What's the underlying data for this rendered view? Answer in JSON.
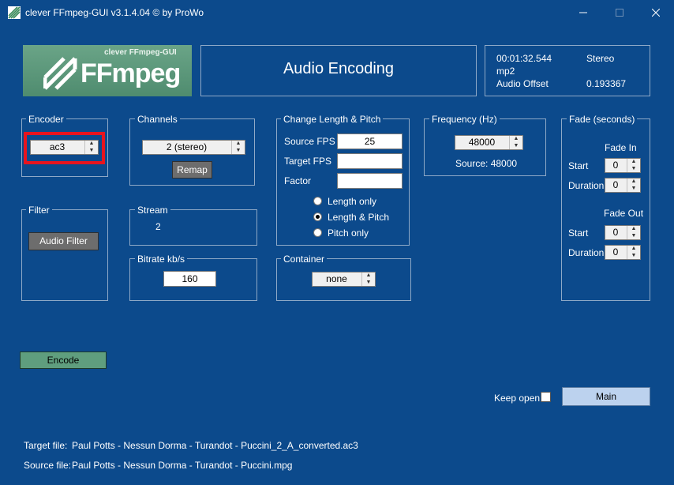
{
  "window": {
    "title": "clever FFmpeg-GUI v3.1.4.04   © by ProWo",
    "minimize_icon": "minimize-icon",
    "maximize_icon": "maximize-icon",
    "close_icon": "close-icon"
  },
  "logo": {
    "subtitle": "clever FFmpeg-GUI",
    "name": "FFmpeg"
  },
  "header": {
    "title": "Audio Encoding"
  },
  "info": {
    "duration": "00:01:32.544",
    "channels_mode": "Stereo",
    "codec": "mp2",
    "audio_offset_label": "Audio Offset",
    "audio_offset_value": "0.193367"
  },
  "encoder": {
    "legend": "Encoder",
    "value": "ac3"
  },
  "channels": {
    "legend": "Channels",
    "value": "2 (stereo)",
    "remap_label": "Remap"
  },
  "pitch": {
    "legend": "Change Length & Pitch",
    "source_fps_label": "Source FPS",
    "source_fps_value": "25",
    "target_fps_label": "Target FPS",
    "target_fps_value": "",
    "factor_label": "Factor",
    "factor_value": "",
    "options": [
      "Length only",
      "Length & Pitch",
      "Pitch only"
    ],
    "selected": "Length & Pitch"
  },
  "frequency": {
    "legend": "Frequency (Hz)",
    "value": "48000",
    "source": "Source: 48000"
  },
  "fade": {
    "legend": "Fade (seconds)",
    "fade_in_label": "Fade In",
    "fade_out_label": "Fade Out",
    "start_label": "Start",
    "duration_label": "Duration",
    "in_start": "0",
    "in_duration": "0",
    "out_start": "0",
    "out_duration": "0"
  },
  "filter": {
    "legend": "Filter",
    "button_label": "Audio Filter"
  },
  "stream": {
    "legend": "Stream",
    "value": "2"
  },
  "bitrate": {
    "legend": "Bitrate kb/s",
    "value": "160"
  },
  "container": {
    "legend": "Container",
    "value": "none"
  },
  "actions": {
    "encode_label": "Encode",
    "keep_open_label": "Keep open",
    "keep_open_checked": false,
    "main_label": "Main"
  },
  "files": {
    "target_label": "Target file:",
    "target_value": "Paul Potts - Nessun Dorma - Turandot - Puccini_2_A_converted.ac3",
    "source_label": "Source file:",
    "source_value": "Paul Potts - Nessun Dorma - Turandot - Puccini.mpg"
  },
  "colors": {
    "background": "#0c4a8c",
    "logo_green": "#5a9a7b",
    "encode_green": "#5f9e7e",
    "main_blue": "#bcd2ee",
    "highlight_red": "#e8141e"
  }
}
